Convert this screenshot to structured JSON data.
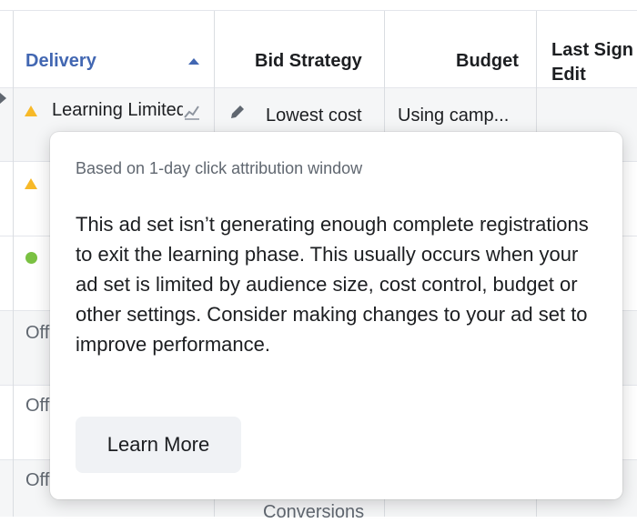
{
  "table": {
    "headers": {
      "delivery": "Delivery",
      "bid_strategy": "Bid Strategy",
      "budget": "Budget",
      "last_significant_edit": "Last Sign\nEdit"
    },
    "rows": [
      {
        "delivery_status": "Learning Limited",
        "bid_strategy": "Lowest cost",
        "budget": "Using camp..."
      },
      {
        "delivery_status": "Off"
      },
      {
        "delivery_status": "Off"
      },
      {
        "delivery_status": "Off"
      },
      {
        "bid_strategy": "Conversions"
      }
    ]
  },
  "tooltip": {
    "caption": "Based on 1-day click attribution window",
    "body": "This ad set isn’t generating enough complete registrations to exit the learning phase. This usually occurs when your ad set is limited by audience size, cost control, budget or other settings. Consider making changes to your ad set to improve performance.",
    "button_label": "Learn More"
  },
  "colors": {
    "accent": "#4267b2",
    "warning": "#f7b928",
    "active": "#7ac142"
  },
  "icons": [
    "sort-ascending-icon",
    "warning-triangle-icon",
    "chart-icon",
    "pencil-icon",
    "green-dot-icon"
  ]
}
